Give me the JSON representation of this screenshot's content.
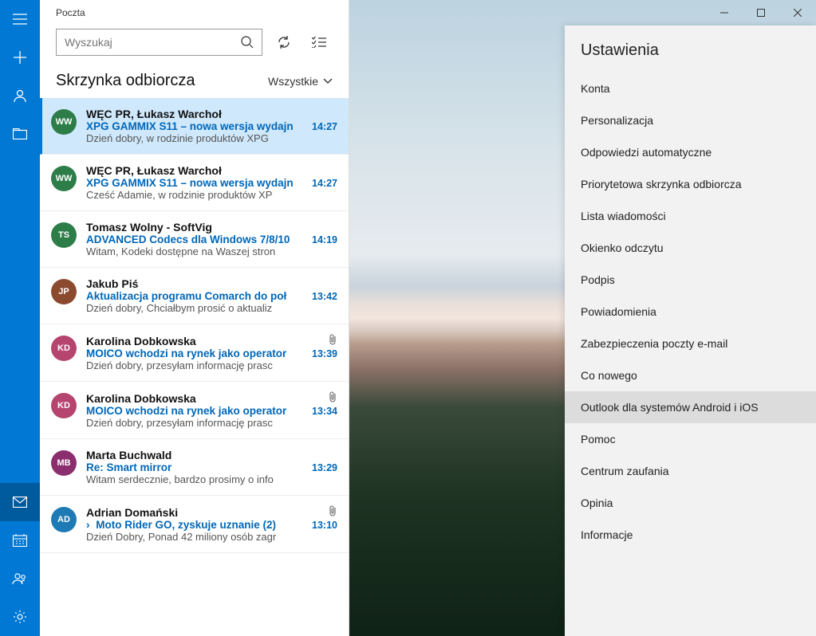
{
  "app_title": "Poczta",
  "search_placeholder": "Wyszukaj",
  "folder_title": "Skrzynka odbiorcza",
  "filter_label": "Wszystkie",
  "messages": [
    {
      "initials": "WW",
      "color": "#2d7d48",
      "sender": "WĘC PR, Łukasz Warchoł",
      "subject": "XPG GAMMIX S11 – nowa wersja wydajn",
      "time": "14:27",
      "preview": "Dzień dobry, w rodzinie produktów XPG",
      "attachment": false,
      "selected": true,
      "threaded": false
    },
    {
      "initials": "WW",
      "color": "#2d7d48",
      "sender": "WĘC PR, Łukasz Warchoł",
      "subject": "XPG GAMMIX S11 – nowa wersja wydajn",
      "time": "14:27",
      "preview": "Cześć Adamie, w rodzinie produktów XP",
      "attachment": false,
      "selected": false,
      "threaded": false
    },
    {
      "initials": "TS",
      "color": "#2d7d48",
      "sender": "Tomasz Wolny - SoftVig",
      "subject": "ADVANCED Codecs dla Windows 7/8/10",
      "time": "14:19",
      "preview": "Witam, Kodeki dostępne na Waszej stron",
      "attachment": false,
      "selected": false,
      "threaded": false
    },
    {
      "initials": "JP",
      "color": "#8b4a2e",
      "sender": "Jakub Piś",
      "subject": "Aktualizacja programu Comarch do poł",
      "time": "13:42",
      "preview": "Dzień dobry, Chciałbym prosić o aktualiz",
      "attachment": false,
      "selected": false,
      "threaded": false
    },
    {
      "initials": "KD",
      "color": "#b5446e",
      "sender": "Karolina Dobkowska",
      "subject": "MOICO wchodzi na rynek jako operator",
      "time": "13:39",
      "preview": "Dzień dobry, przesyłam informację prasc",
      "attachment": true,
      "selected": false,
      "threaded": false
    },
    {
      "initials": "KD",
      "color": "#b5446e",
      "sender": "Karolina Dobkowska",
      "subject": "MOICO wchodzi na rynek jako operator",
      "time": "13:34",
      "preview": "Dzień dobry, przesyłam informację prasc",
      "attachment": true,
      "selected": false,
      "threaded": false
    },
    {
      "initials": "MB",
      "color": "#8b2e6e",
      "sender": "Marta Buchwald",
      "subject": "Re: Smart mirror",
      "time": "13:29",
      "preview": "Witam serdecznie, bardzo prosimy o info",
      "attachment": false,
      "selected": false,
      "threaded": false
    },
    {
      "initials": "AD",
      "color": "#1e7ab5",
      "sender": "Adrian Domański",
      "subject": "Moto Rider GO, zyskuje uznanie",
      "thread_count": "(2)",
      "time": "13:10",
      "preview": "Dzień Dobry, Ponad 42 miliony osób zagr",
      "attachment": true,
      "selected": false,
      "threaded": true
    }
  ],
  "settings_title": "Ustawienia",
  "settings_items": [
    {
      "label": "Konta",
      "highlight": false
    },
    {
      "label": "Personalizacja",
      "highlight": false
    },
    {
      "label": "Odpowiedzi automatyczne",
      "highlight": false
    },
    {
      "label": "Priorytetowa skrzynka odbiorcza",
      "highlight": false
    },
    {
      "label": "Lista wiadomości",
      "highlight": false
    },
    {
      "label": "Okienko odczytu",
      "highlight": false
    },
    {
      "label": "Podpis",
      "highlight": false
    },
    {
      "label": "Powiadomienia",
      "highlight": false
    },
    {
      "label": "Zabezpieczenia poczty e-mail",
      "highlight": false
    },
    {
      "label": "Co nowego",
      "highlight": false
    },
    {
      "label": "Outlook dla systemów Android i iOS",
      "highlight": true
    },
    {
      "label": "Pomoc",
      "highlight": false
    },
    {
      "label": "Centrum zaufania",
      "highlight": false
    },
    {
      "label": "Opinia",
      "highlight": false
    },
    {
      "label": "Informacje",
      "highlight": false
    }
  ]
}
